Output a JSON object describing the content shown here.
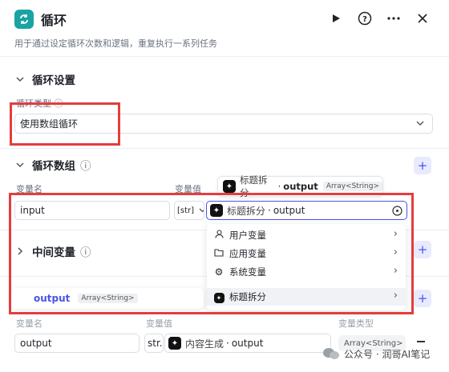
{
  "header": {
    "title": "循环",
    "description": "用于通过设定循环次数和逻辑，重复执行一系列任务"
  },
  "loop_settings": {
    "section_title": "循环设置",
    "type_label": "循环类型",
    "type_value": "使用数组循环"
  },
  "loop_array": {
    "section_title": "循环数组",
    "col_name": "变量名",
    "col_value": "变量值",
    "name_value": "input",
    "type_tag": "[str]",
    "ref_node": "标题拆分",
    "ref_var": "output",
    "tooltip": {
      "node": "标题拆分",
      "var": "output",
      "type": "Array<String>"
    }
  },
  "intermediate": {
    "section_title": "中间变量"
  },
  "menu": {
    "items": [
      {
        "icon": "user-icon",
        "label": "用户变量"
      },
      {
        "icon": "folder-icon",
        "label": "应用变量"
      },
      {
        "icon": "gear-icon",
        "label": "系统变量"
      },
      {
        "icon": "node-icon",
        "label": "标题拆分"
      }
    ]
  },
  "submenu": {
    "var": "output",
    "type": "Array<String>"
  },
  "output_row": {
    "col_name": "变量名",
    "col_value": "变量值",
    "col_type": "变量类型",
    "name_value": "output",
    "type_tag": "str.",
    "ref_node": "内容生成",
    "ref_var": "output",
    "type_value": "Array<String>"
  },
  "watermark": "公众号 · 润哥AI笔记",
  "colors": {
    "accent": "#4d53e8",
    "highlight": "#e43d3d",
    "brand": "#1aa3a3"
  }
}
